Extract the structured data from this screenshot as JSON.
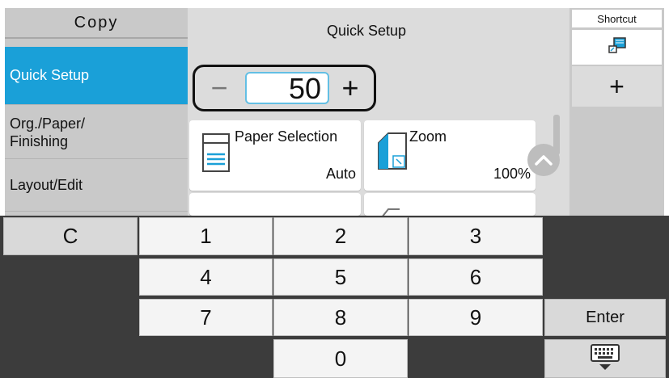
{
  "sidebar": {
    "title": "Copy",
    "items": [
      {
        "label": "Quick Setup",
        "active": true
      },
      {
        "label_line1": "Org./Paper/",
        "label_line2": "Finishing",
        "active": false
      },
      {
        "label": "Layout/Edit",
        "active": false
      }
    ]
  },
  "main": {
    "title": "Quick Setup",
    "stepper": {
      "minus": "−",
      "value": "50",
      "plus": "+"
    },
    "tiles": [
      {
        "label": "Paper Selection",
        "value": "Auto",
        "icon": "paper-tray-icon"
      },
      {
        "label": "Zoom",
        "value": "100%",
        "icon": "zoom-icon"
      }
    ],
    "scroll_up_icon": "chevron-up-icon"
  },
  "shortcut": {
    "title": "Shortcut",
    "icon": "shortcut-icon",
    "add": "+"
  },
  "keypad": {
    "clear": "C",
    "digits": [
      "1",
      "2",
      "3",
      "4",
      "5",
      "6",
      "7",
      "8",
      "9",
      "0"
    ],
    "enter": "Enter",
    "keyboard_icon": "keyboard-icon"
  },
  "colors": {
    "accent": "#1aa0d8",
    "sidebar_bg": "#c9c9c9",
    "main_bg": "#dcdcdc",
    "keypad_bg": "#3c3c3c",
    "input_border": "#63bfe4"
  }
}
